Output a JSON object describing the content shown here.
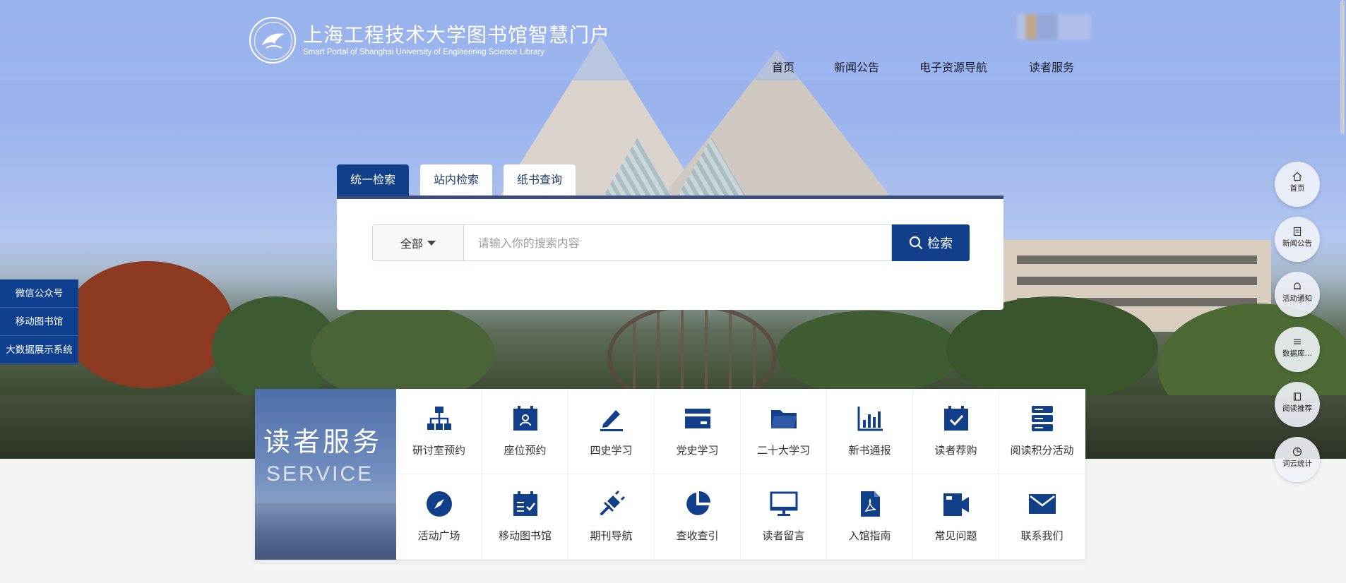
{
  "header": {
    "logo_cn": "上海工程技术大学图书馆智慧门户",
    "logo_en": "Smart Portal of Shanghai University of Engineering Science Library",
    "nav": [
      "首页",
      "新闻公告",
      "电子资源导航",
      "读者服务"
    ]
  },
  "search": {
    "tabs": [
      "统一检索",
      "站内检索",
      "纸书查询"
    ],
    "active_tab": 0,
    "scope": "全部",
    "placeholder": "请输入你的搜索内容",
    "button": "检索"
  },
  "left_links": [
    "微信公众号",
    "移动图书馆",
    "大数据展示系统"
  ],
  "right_float": [
    {
      "label": "首页",
      "icon": "home-icon"
    },
    {
      "label": "新闻公告",
      "icon": "news-icon"
    },
    {
      "label": "活动通知",
      "icon": "bell-icon"
    },
    {
      "label": "数据库…",
      "icon": "database-icon"
    },
    {
      "label": "阅读推荐",
      "icon": "book-icon"
    },
    {
      "label": "词云统计",
      "icon": "pie-icon"
    }
  ],
  "service": {
    "title_cn": "读者服务",
    "title_en": "SERVICE",
    "items": [
      {
        "label": "研讨室预约",
        "icon": "org-chart-icon"
      },
      {
        "label": "座位预约",
        "icon": "calendar-person-icon"
      },
      {
        "label": "四史学习",
        "icon": "pen-icon"
      },
      {
        "label": "党史学习",
        "icon": "card-icon"
      },
      {
        "label": "二十大学习",
        "icon": "folder-icon"
      },
      {
        "label": "新书通报",
        "icon": "bar-chart-icon"
      },
      {
        "label": "读者荐购",
        "icon": "calendar-check-icon"
      },
      {
        "label": "阅读积分活动",
        "icon": "server-icon"
      },
      {
        "label": "活动广场",
        "icon": "compass-icon"
      },
      {
        "label": "移动图书馆",
        "icon": "calendar-list-icon"
      },
      {
        "label": "期刊导航",
        "icon": "plug-icon"
      },
      {
        "label": "查收查引",
        "icon": "pie-chart-icon"
      },
      {
        "label": "读者留言",
        "icon": "monitor-icon"
      },
      {
        "label": "入馆指南",
        "icon": "pdf-icon"
      },
      {
        "label": "常见问题",
        "icon": "video-icon"
      },
      {
        "label": "联系我们",
        "icon": "mail-icon"
      }
    ]
  },
  "colors": {
    "primary": "#123f8a",
    "header_overlay": "#a0b9f0"
  }
}
